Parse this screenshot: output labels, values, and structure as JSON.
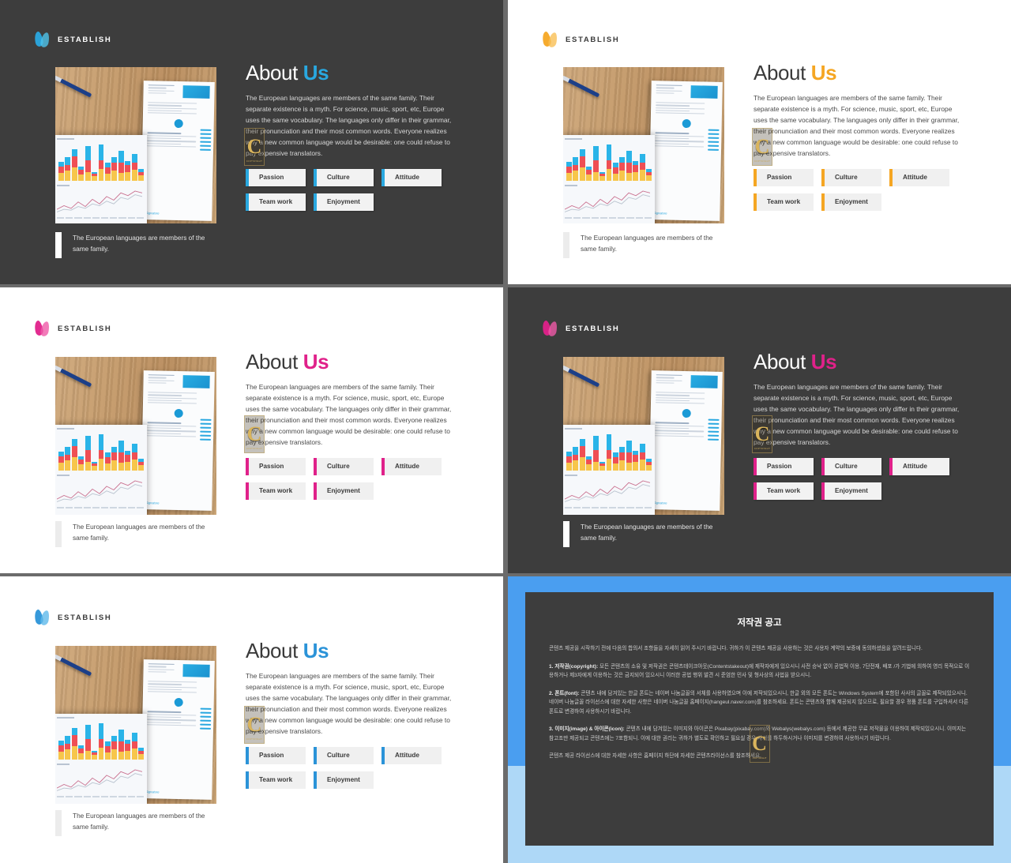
{
  "deck": {
    "brand": "ESTABLISH",
    "title_plain": "About ",
    "title_accent": "Us",
    "body": "The European languages are members of the same family.  Their separate existence is a myth. For science, music, sport, etc, Europe uses the same vocabulary. The languages only differ in their grammar, their pronunciation and their most common words. Everyone realizes why a new common language would be desirable: one could refuse to pay expensive translators.",
    "caption": "The European languages are members of the same family.",
    "pills": [
      "Passion",
      "Culture",
      "Attitude",
      "Team work",
      "Enjoyment"
    ],
    "watermark": {
      "glyph": "C",
      "sub": "COPYRIGHT"
    }
  },
  "slides": [
    {
      "name": "slide-1-dark-blue",
      "theme": "dark",
      "accent": "#29a8e0"
    },
    {
      "name": "slide-2-light-orange",
      "theme": "light",
      "accent": "#f5a623"
    },
    {
      "name": "slide-3-light-pink",
      "theme": "light",
      "accent": "#e0218a"
    },
    {
      "name": "slide-4-dark-pink",
      "theme": "dark",
      "accent": "#e0218a"
    },
    {
      "name": "slide-5-light-blue",
      "theme": "light",
      "accent": "#2b93d8"
    }
  ],
  "copyright": {
    "frame_color": "#4a9ef0",
    "band_color": "#aed8f7",
    "title": "저작권 공고",
    "paragraphs": [
      "콘텐츠 제공을 시작하기 전에 다음의 합의서 조항들을 자세히 읽어 주시기 바랍니다. 귀하가 이 콘텐츠 제공을 사용하는 것은 사용자 계약의 보증에 동의하셨음을 알려드립니다.",
      "1. 저작권(copyright): 모든 콘텐츠의 소유 및 저작권은 콘텐츠테이크아웃(Contentstakeout)에 제작자에게 있으시니 사전 승낙 없이 공법적 이용, 7단전재, 배포 /가 기법에 의하여 영리 목적으로 이용하거나 제3자에게 이용하는 것은 금지되어 있으시니 이러한 공법 행위 발견 시 준엄한 민사 및 형사상의 사법을 받으시니.",
      "2. 폰트(font): 콘텐츠 내에 담겨있는 한글 폰트는 네이버 나눔글꼴의 서체를 사용하였으며 이에 저작되있으시니, 한글 외의 모든 폰트는 Windows System에 포함된 사사의 글꼴로 제작되있으시니. 네이버 나눔글꼴 라이선스에 대한 자세한 사항은 네이버 나눔글꼴 홈페이지(hangeul.naver.com)를 참조하세요. 폰트는 콘텐츠와 함께 제공되지 않으므로, 필요할 경우 정품 폰트를 구입하셔서 다른 폰트로 변경하여 사용하시기 바랍니다.",
      "3. 이미지(image) & 아이콘(icon): 콘텐츠 내에 담겨있는 이미지와 아이콘은 Pixabay(pixabay.com)와 Webalys(webalys.com) 등에서 제공한 무료 저작물을 이용하여 제작되있으시니. 이미지는 참고조만 제공되고 콘텐츠에는 7포함되니. 이에 대한 권리는 귀하가 별도로 확인하고 필요실 경우 사서를 하두하시거나 이미지를 변경하여 사용하시기 바랍니다.",
      "콘텐츠 제공 라이선스에 대한 자세한 사항은 홈페이지 하단에 자세한 콘텐츠라이선스를 참조하세요."
    ]
  },
  "photo": {
    "name": "desk-photo-with-charts",
    "chart_data": {
      "type": "bar",
      "title": "",
      "categories": [
        "1",
        "2",
        "3",
        "4",
        "5",
        "6",
        "7",
        "8",
        "9",
        "10",
        "11",
        "12",
        "13"
      ],
      "series": [
        {
          "name": "yellow",
          "color": "#f7c64b",
          "values": [
            18,
            22,
            30,
            14,
            20,
            10,
            26,
            16,
            22,
            18,
            20,
            24,
            12
          ]
        },
        {
          "name": "red",
          "color": "#ef4f54",
          "values": [
            14,
            12,
            24,
            10,
            26,
            6,
            20,
            14,
            18,
            22,
            14,
            16,
            8
          ]
        },
        {
          "name": "blue",
          "color": "#2ab4e8",
          "values": [
            10,
            18,
            16,
            8,
            30,
            4,
            34,
            10,
            12,
            26,
            10,
            20,
            6
          ]
        }
      ],
      "ylim": [
        0,
        80
      ],
      "grid": false
    },
    "line_data": {
      "type": "line",
      "x": [
        0,
        1,
        2,
        3,
        4,
        5,
        6,
        7,
        8,
        9,
        10,
        11,
        12
      ],
      "series": [
        {
          "name": "pink",
          "color": "#c96f8e",
          "values": [
            6,
            10,
            7,
            14,
            9,
            17,
            12,
            20,
            16,
            24,
            21,
            26,
            24
          ]
        },
        {
          "name": "gray",
          "color": "#b9c3cf",
          "values": [
            3,
            6,
            5,
            9,
            7,
            12,
            10,
            15,
            12,
            19,
            17,
            22,
            20
          ]
        }
      ]
    }
  }
}
